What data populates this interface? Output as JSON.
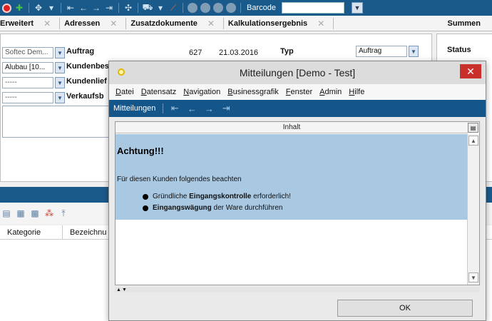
{
  "toolbar": {
    "barcode_label": "Barcode",
    "barcode_value": ""
  },
  "tabs": [
    {
      "label": "Erweitert"
    },
    {
      "label": "Adressen"
    },
    {
      "label": "Zusatzdokumente"
    },
    {
      "label": "Kalkulationsergebnis"
    },
    {
      "label": "Summen"
    }
  ],
  "form": {
    "field1": "Softec Dem...",
    "field2": "Alubau [10...",
    "field3": "-----",
    "field4": "-----",
    "label_auftrag": "Auftrag",
    "label_kundenbes": "Kundenbes",
    "label_kundenlief": "Kundenlief",
    "label_verkaufsb": "Verkaufsb",
    "number": "627",
    "date": "21.03.2016",
    "typ_label": "Typ",
    "typ_value": "Auftrag",
    "status_label": "Status"
  },
  "list": {
    "columns": [
      "Kategorie",
      "Bezeichnu"
    ]
  },
  "dialog": {
    "title": "Mitteilungen [Demo - Test]",
    "menu": [
      "Datei",
      "Datensatz",
      "Navigation",
      "Businessgrafik",
      "Fenster",
      "Admin",
      "Hilfe"
    ],
    "nav_title": "Mitteilungen",
    "content_header": "Inhalt",
    "message": {
      "title": "Achtung!!!",
      "intro": "Für diesen Kunden folgendes beachten",
      "bullet1_pre": "Gründliche ",
      "bullet1_bold": "Eingangskontrolle",
      "bullet1_post": " erforderlich!",
      "bullet2_bold": "Eingangswägung",
      "bullet2_post": " der Ware durchführen"
    },
    "ok_label": "OK"
  },
  "colors": {
    "toolbar_blue": "#1a5a8a",
    "message_bg": "#a9c8e2",
    "close_red": "#c9302c"
  }
}
